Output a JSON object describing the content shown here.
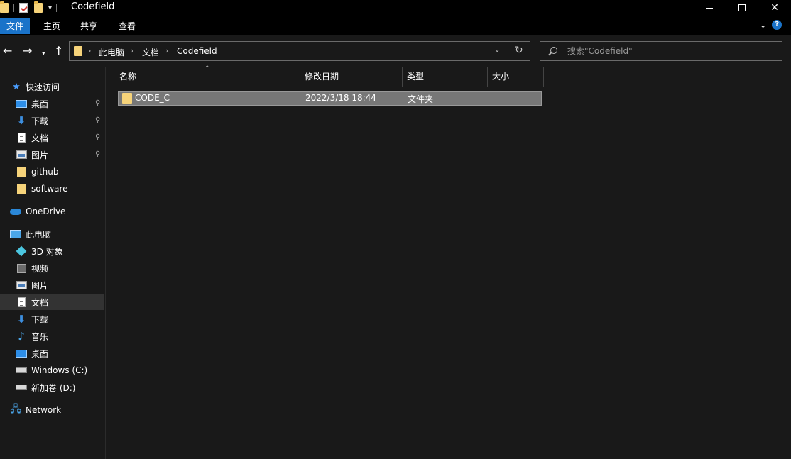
{
  "window": {
    "title": "Codefield",
    "minimize_icon": "minimize-icon",
    "maximize_icon": "maximize-icon",
    "close_icon": "close-icon",
    "close_glyph": "✕"
  },
  "ribbon": {
    "tabs": [
      "文件",
      "主页",
      "共享",
      "查看"
    ],
    "active_tab_color": "#1a73c9",
    "expand_glyph": "⌄",
    "help_glyph": "?"
  },
  "nav": {
    "back_glyph": "←",
    "forward_glyph": "→",
    "recent_glyph": "▾",
    "up_glyph": "↑",
    "breadcrumb": [
      "此电脑",
      "文档",
      "Codefield"
    ],
    "crumb_separator": "›",
    "dropdown_glyph": "⌄",
    "refresh_glyph": "↻",
    "search_placeholder": "搜索\"Codefield\""
  },
  "sidebar": {
    "quick_access": "快速访问",
    "quick_items": [
      {
        "label": "桌面",
        "icon": "desktop-icon",
        "pinned": true
      },
      {
        "label": "下载",
        "icon": "download-icon",
        "pinned": true
      },
      {
        "label": "文档",
        "icon": "document-icon",
        "pinned": true
      },
      {
        "label": "图片",
        "icon": "pictures-icon",
        "pinned": true
      },
      {
        "label": "github",
        "icon": "folder-icon",
        "pinned": false
      },
      {
        "label": "software",
        "icon": "folder-icon",
        "pinned": false
      }
    ],
    "onedrive": "OneDrive",
    "this_pc": "此电脑",
    "pc_items": [
      {
        "label": "3D 对象",
        "icon": "3d-objects-icon"
      },
      {
        "label": "视频",
        "icon": "videos-icon"
      },
      {
        "label": "图片",
        "icon": "pictures-icon"
      },
      {
        "label": "文档",
        "icon": "document-icon",
        "selected": true
      },
      {
        "label": "下载",
        "icon": "download-icon"
      },
      {
        "label": "音乐",
        "icon": "music-icon"
      },
      {
        "label": "桌面",
        "icon": "desktop-icon"
      },
      {
        "label": "Windows (C:)",
        "icon": "windows-drive-icon"
      },
      {
        "label": "新加卷 (D:)",
        "icon": "drive-icon"
      }
    ],
    "network": "Network",
    "pin_glyph": "📌",
    "star_glyph": "★",
    "download_glyph": "⬇",
    "music_glyph": "♪",
    "network_glyph": "🖧"
  },
  "details": {
    "columns": [
      "名称",
      "修改日期",
      "类型",
      "大小"
    ],
    "sort_glyph": "^",
    "rows": [
      {
        "name": "CODE_C",
        "modified": "2022/3/18 18:44",
        "type": "文件夹",
        "size": ""
      }
    ]
  }
}
